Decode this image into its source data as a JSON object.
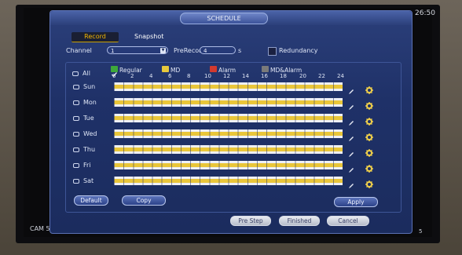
{
  "window": {
    "title": "SCHEDULE",
    "clock": "26:50",
    "camera_label": "CAM 5",
    "channel_number": "5"
  },
  "tabs": [
    {
      "label": "Record",
      "active": true
    },
    {
      "label": "Snapshot",
      "active": false
    }
  ],
  "controls": {
    "channel_label": "Channel",
    "channel_value": "1",
    "prerecord_label": "PreRecord",
    "prerecord_value": "4",
    "prerecord_unit": "s",
    "redundancy_label": "Redundancy",
    "redundancy_checked": false
  },
  "legend": [
    {
      "label": "Regular",
      "color": "#3ea83a",
      "checked": true
    },
    {
      "label": "MD",
      "color": "#e7c83c",
      "checked": false
    },
    {
      "label": "Alarm",
      "color": "#d33a2f",
      "checked": false
    },
    {
      "label": "MD&Alarm",
      "color": "#7a7a7a",
      "checked": false
    }
  ],
  "all_label": "All",
  "hours": [
    "0",
    "2",
    "4",
    "6",
    "8",
    "10",
    "12",
    "14",
    "16",
    "18",
    "20",
    "22",
    "24"
  ],
  "days": [
    "Sun",
    "Mon",
    "Tue",
    "Wed",
    "Thu",
    "Fri",
    "Sat"
  ],
  "schedule_coverage": [
    1,
    1,
    1,
    1,
    1,
    1,
    1
  ],
  "buttons": {
    "default": "Default",
    "copy": "Copy",
    "apply": "Apply",
    "pre_step": "Pre Step",
    "finished": "Finished",
    "cancel": "Cancel"
  },
  "colors": {
    "accent": "#f0b400",
    "bar_fill": "#e9c63a",
    "dialog_bg": "#1f3168"
  }
}
